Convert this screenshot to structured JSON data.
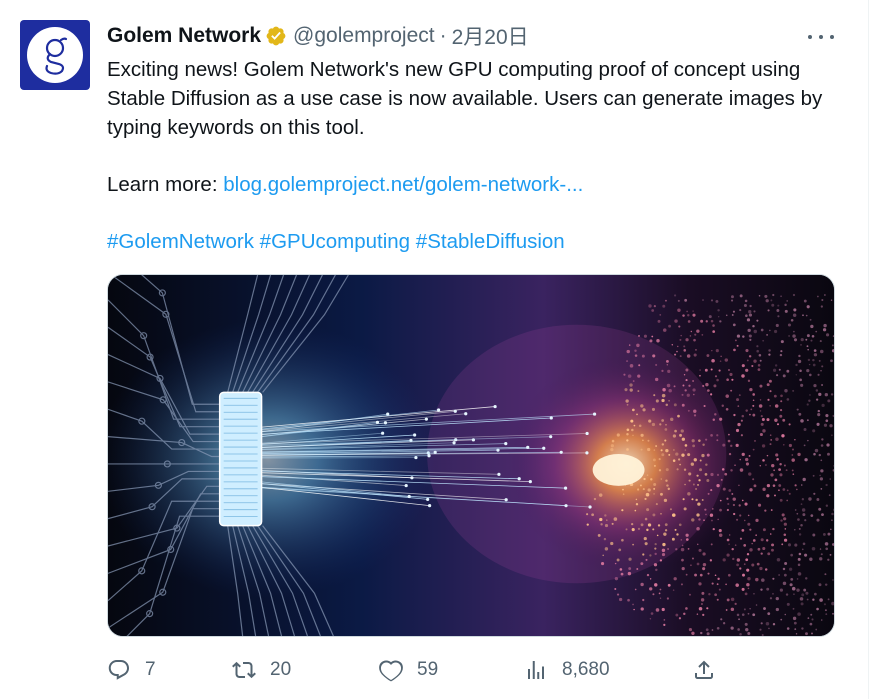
{
  "author": {
    "display_name": "Golem Network",
    "handle": "@golemproject",
    "separator": "·",
    "date": "2月20日",
    "avatar_letter": "g",
    "avatar_color": "#1e2d9f",
    "verified_color": "#e2b719"
  },
  "tweet": {
    "text": "Exciting news! Golem Network's new GPU computing proof of concept using Stable Diffusion as a use case is now available. Users can generate images by typing keywords on this tool.",
    "learn_more_label": "Learn more: ",
    "link_text": "blog.golemproject.net/golem-network-...",
    "hashtags": [
      "#GolemNetwork",
      "#GPUcomputing",
      "#StableDiffusion"
    ]
  },
  "media": {
    "description_icon": "ai-chip-to-face-illustration"
  },
  "actions": {
    "reply_count": "7",
    "retweet_count": "20",
    "like_count": "59",
    "view_count": "8,680"
  },
  "colors": {
    "link": "#1d9bf0",
    "muted": "#536471",
    "text": "#0f1419"
  }
}
